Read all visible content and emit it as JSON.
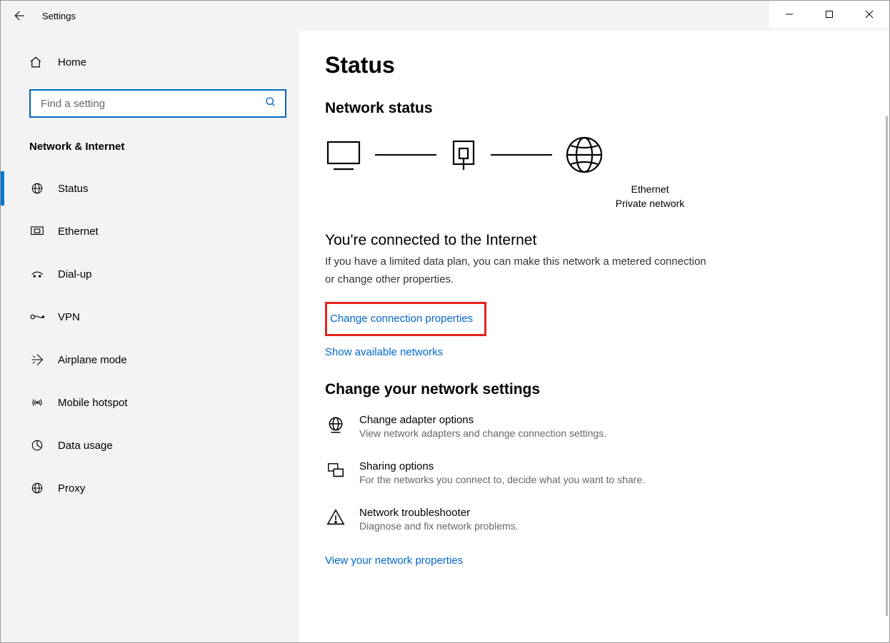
{
  "window": {
    "title": "Settings"
  },
  "sidebar": {
    "home": "Home",
    "search_placeholder": "Find a setting",
    "category": "Network & Internet",
    "items": [
      {
        "label": "Status",
        "active": true
      },
      {
        "label": "Ethernet"
      },
      {
        "label": "Dial-up"
      },
      {
        "label": "VPN"
      },
      {
        "label": "Airplane mode"
      },
      {
        "label": "Mobile hotspot"
      },
      {
        "label": "Data usage"
      },
      {
        "label": "Proxy"
      }
    ]
  },
  "main": {
    "page_title": "Status",
    "network_status_heading": "Network status",
    "diagram": {
      "connection_label": "Ethernet",
      "network_type": "Private network"
    },
    "connected_heading": "You're connected to the Internet",
    "connected_desc": "If you have a limited data plan, you can make this network a metered connection or change other properties.",
    "link_change_properties": "Change connection properties",
    "link_show_networks": "Show available networks",
    "change_settings_heading": "Change your network settings",
    "items": [
      {
        "title": "Change adapter options",
        "sub": "View network adapters and change connection settings."
      },
      {
        "title": "Sharing options",
        "sub": "For the networks you connect to, decide what you want to share."
      },
      {
        "title": "Network troubleshooter",
        "sub": "Diagnose and fix network problems."
      }
    ],
    "link_view_properties": "View your network properties"
  }
}
